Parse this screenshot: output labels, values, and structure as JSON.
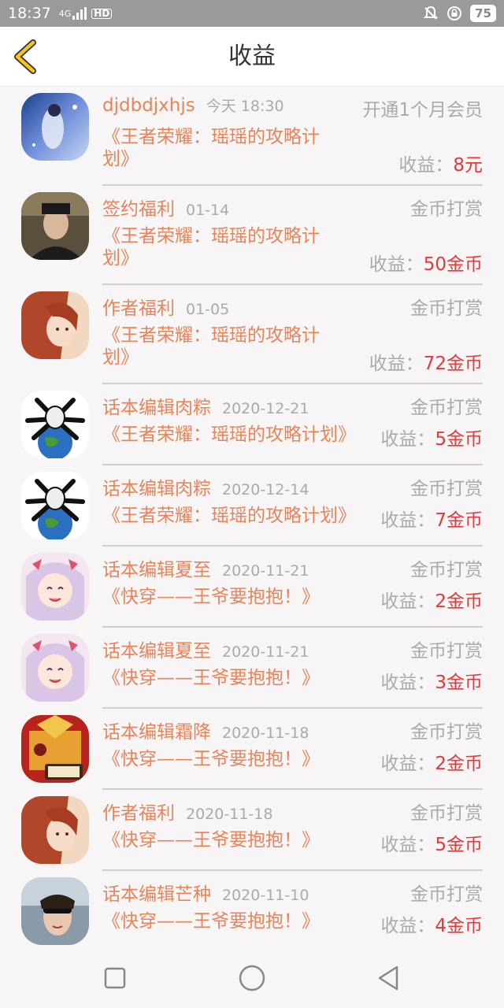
{
  "status_bar": {
    "time": "18:37",
    "network": "4G",
    "hd_label": "HD",
    "battery": "75"
  },
  "header": {
    "title": "收益",
    "back_icon": "chevron-left-icon",
    "accent": "#f5c518"
  },
  "records": [
    {
      "name": "djdbdjxhjs",
      "date": "今天 18:30",
      "type": "开通1个月会员",
      "book_line1": "《王者荣耀：瑶瑶的攻略计",
      "book_line2": "划》",
      "earn_label": "收益：",
      "amount": "8元"
    },
    {
      "name": "签约福利",
      "date": "01-14",
      "type": "金币打赏",
      "book_line1": "《王者荣耀：瑶瑶的攻略计",
      "book_line2": "划》",
      "earn_label": "收益：",
      "amount": "50金币"
    },
    {
      "name": "作者福利",
      "date": "01-05",
      "type": "金币打赏",
      "book_line1": "《王者荣耀：瑶瑶的攻略计",
      "book_line2": "划》",
      "earn_label": "收益：",
      "amount": "72金币"
    },
    {
      "name": "话本编辑肉粽",
      "date": "2020-12-21",
      "type": "金币打赏",
      "book_line1": "《王者荣耀：瑶瑶的攻略计划》",
      "book_line2": "",
      "earn_label": "收益：",
      "amount": "5金币"
    },
    {
      "name": "话本编辑肉粽",
      "date": "2020-12-14",
      "type": "金币打赏",
      "book_line1": "《王者荣耀：瑶瑶的攻略计划》",
      "book_line2": "",
      "earn_label": "收益：",
      "amount": "7金币"
    },
    {
      "name": "话本编辑夏至",
      "date": "2020-11-21",
      "type": "金币打赏",
      "book_line1": "《快穿——王爷要抱抱！》",
      "book_line2": "",
      "earn_label": "收益：",
      "amount": "2金币"
    },
    {
      "name": "话本编辑夏至",
      "date": "2020-11-21",
      "type": "金币打赏",
      "book_line1": "《快穿——王爷要抱抱！》",
      "book_line2": "",
      "earn_label": "收益：",
      "amount": "3金币"
    },
    {
      "name": "话本编辑霜降",
      "date": "2020-11-18",
      "type": "金币打赏",
      "book_line1": "《快穿——王爷要抱抱！》",
      "book_line2": "",
      "earn_label": "收益：",
      "amount": "2金币"
    },
    {
      "name": "作者福利",
      "date": "2020-11-18",
      "type": "金币打赏",
      "book_line1": "《快穿——王爷要抱抱！》",
      "book_line2": "",
      "earn_label": "收益：",
      "amount": "5金币"
    },
    {
      "name": "话本编辑芒种",
      "date": "2020-11-10",
      "type": "金币打赏",
      "book_line1": "《快穿——王爷要抱抱！》",
      "book_line2": "",
      "earn_label": "收益：",
      "amount": "4金币"
    }
  ],
  "colors": {
    "name_text": "#e8845a",
    "amount_text": "#e03a3a",
    "muted_text": "#aaaaaa"
  },
  "nav_bar": {
    "recent_icon": "square-icon",
    "home_icon": "circle-icon",
    "back_icon": "triangle-back-icon"
  }
}
